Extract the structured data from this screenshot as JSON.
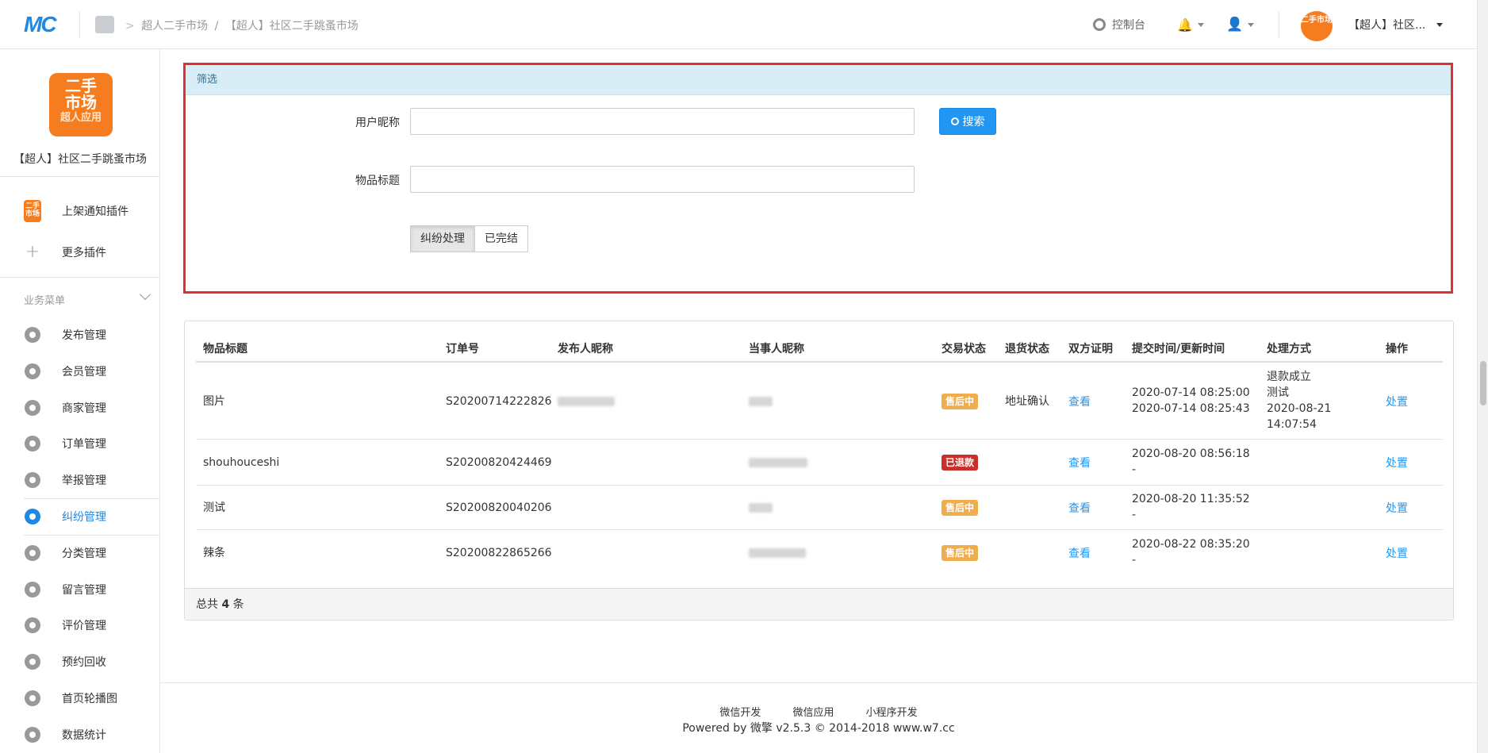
{
  "header": {
    "logo": "MC",
    "breadcrumb": [
      "超人二手市场",
      "/",
      "【超人】社区二手跳蚤市场"
    ],
    "console_label": "控制台",
    "account_name": "【超人】社区...",
    "account_logo_text": "二手市场"
  },
  "sidebar": {
    "brand_logo": {
      "line1": "二手",
      "line2": "市场",
      "line3": "超人应用"
    },
    "brand_name": "【超人】社区二手跳蚤市场",
    "plugins": [
      {
        "label": "上架通知插件"
      },
      {
        "label": "更多插件"
      }
    ],
    "section_title": "业务菜单",
    "items": [
      {
        "label": "发布管理"
      },
      {
        "label": "会员管理"
      },
      {
        "label": "商家管理"
      },
      {
        "label": "订单管理"
      },
      {
        "label": "举报管理"
      },
      {
        "label": "纠纷管理",
        "active": true
      },
      {
        "label": "分类管理"
      },
      {
        "label": "留言管理"
      },
      {
        "label": "评价管理"
      },
      {
        "label": "预约回收"
      },
      {
        "label": "首页轮播图"
      },
      {
        "label": "数据统计"
      }
    ]
  },
  "filter": {
    "title": "筛选",
    "nickname_label": "用户昵称",
    "nickname_value": "",
    "title_label": "物品标题",
    "title_value": "",
    "search_button": "搜索",
    "segments": [
      {
        "label": "纠纷处理",
        "selected": true
      },
      {
        "label": "已完结",
        "selected": false
      }
    ]
  },
  "table": {
    "columns": [
      "物品标题",
      "订单号",
      "发布人昵称",
      "当事人昵称",
      "交易状态",
      "退货状态",
      "双方证明",
      "提交时间/更新时间",
      "处理方式",
      "操作"
    ],
    "rows": [
      {
        "title": "图片",
        "order_no": "S20200714222826",
        "status": "售后中",
        "status_color": "#f0ad4e",
        "return_status": "地址确认",
        "proof": "查看",
        "time1": "2020-07-14 08:25:00",
        "time2": "2020-07-14 08:25:43",
        "method": [
          "退款成立",
          "测试",
          "2020-08-21",
          "14:07:54"
        ],
        "action": "处置"
      },
      {
        "title": "shouhouceshi",
        "order_no": "S20200820424469",
        "status": "已退款",
        "status_color": "#c9302c",
        "return_status": "",
        "proof": "查看",
        "time1": "2020-08-20 08:56:18",
        "time2": "-",
        "method": [],
        "action": "处置"
      },
      {
        "title": "测试",
        "order_no": "S20200820040206",
        "status": "售后中",
        "status_color": "#f0ad4e",
        "return_status": "",
        "proof": "查看",
        "time1": "2020-08-20 11:35:52",
        "time2": "-",
        "method": [],
        "action": "处置"
      },
      {
        "title": "辣条",
        "order_no": "S20200822865266",
        "status": "售后中",
        "status_color": "#f0ad4e",
        "return_status": "",
        "proof": "查看",
        "time1": "2020-08-22 08:35:20",
        "time2": "-",
        "method": [],
        "action": "处置"
      }
    ],
    "total_prefix": "总共",
    "total_count": "4",
    "total_suffix": "条"
  },
  "footer": {
    "links": [
      "微信开发",
      "微信应用",
      "小程序开发"
    ],
    "copyright": "Powered by 微擎 v2.5.3 © 2014-2018 www.w7.cc"
  }
}
